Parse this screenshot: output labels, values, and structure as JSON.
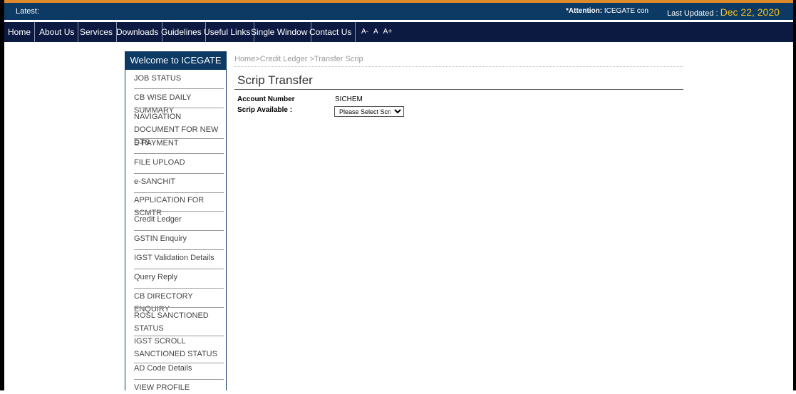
{
  "topbar": {
    "latest_label": "Latest:",
    "attention_prefix": "*Attention:",
    "attention_text": "ICEGATE con",
    "last_updated_label": "Last Updated :",
    "last_updated_date": "Dec 22, 2020"
  },
  "nav": {
    "items": [
      "Home",
      "About Us",
      "Services",
      "Downloads",
      "Guidelines",
      "Useful Links",
      "Single Window",
      "Contact Us"
    ],
    "font_controls": [
      "A-",
      "A",
      "A+"
    ]
  },
  "sidebar": {
    "header": "Welcome to ICEGATE",
    "items": [
      "JOB STATUS",
      "CB WISE DAILY SUMMARY",
      "NAVIGATION DOCUMENT FOR NEW DTS",
      "E-PAYMENT",
      "FILE UPLOAD",
      "e-SANCHIT",
      "APPLICATION FOR SCMTR",
      "Credit Ledger",
      "GSTIN Enquiry",
      "IGST Validation Details",
      "Query Reply",
      "CB DIRECTORY ENQUIRY",
      "ROSL SANCTIONED STATUS",
      "IGST SCROLL SANCTIONED STATUS",
      "AD Code Details",
      "VIEW PROFILE"
    ]
  },
  "main": {
    "breadcrumb": "Home>Credit Ledger >Transfer Scrip",
    "title": "Scrip Transfer",
    "account_label": "Account Number",
    "account_value": "SICHEM",
    "scrip_label": "Scrip Available :",
    "scrip_select": "Please Select Scrip"
  },
  "colors": {
    "topbar_bg": "#0c3a64",
    "nav_bg": "#0c1a42",
    "date_accent": "#ffc21a",
    "top_line": "#dd8a2b"
  }
}
